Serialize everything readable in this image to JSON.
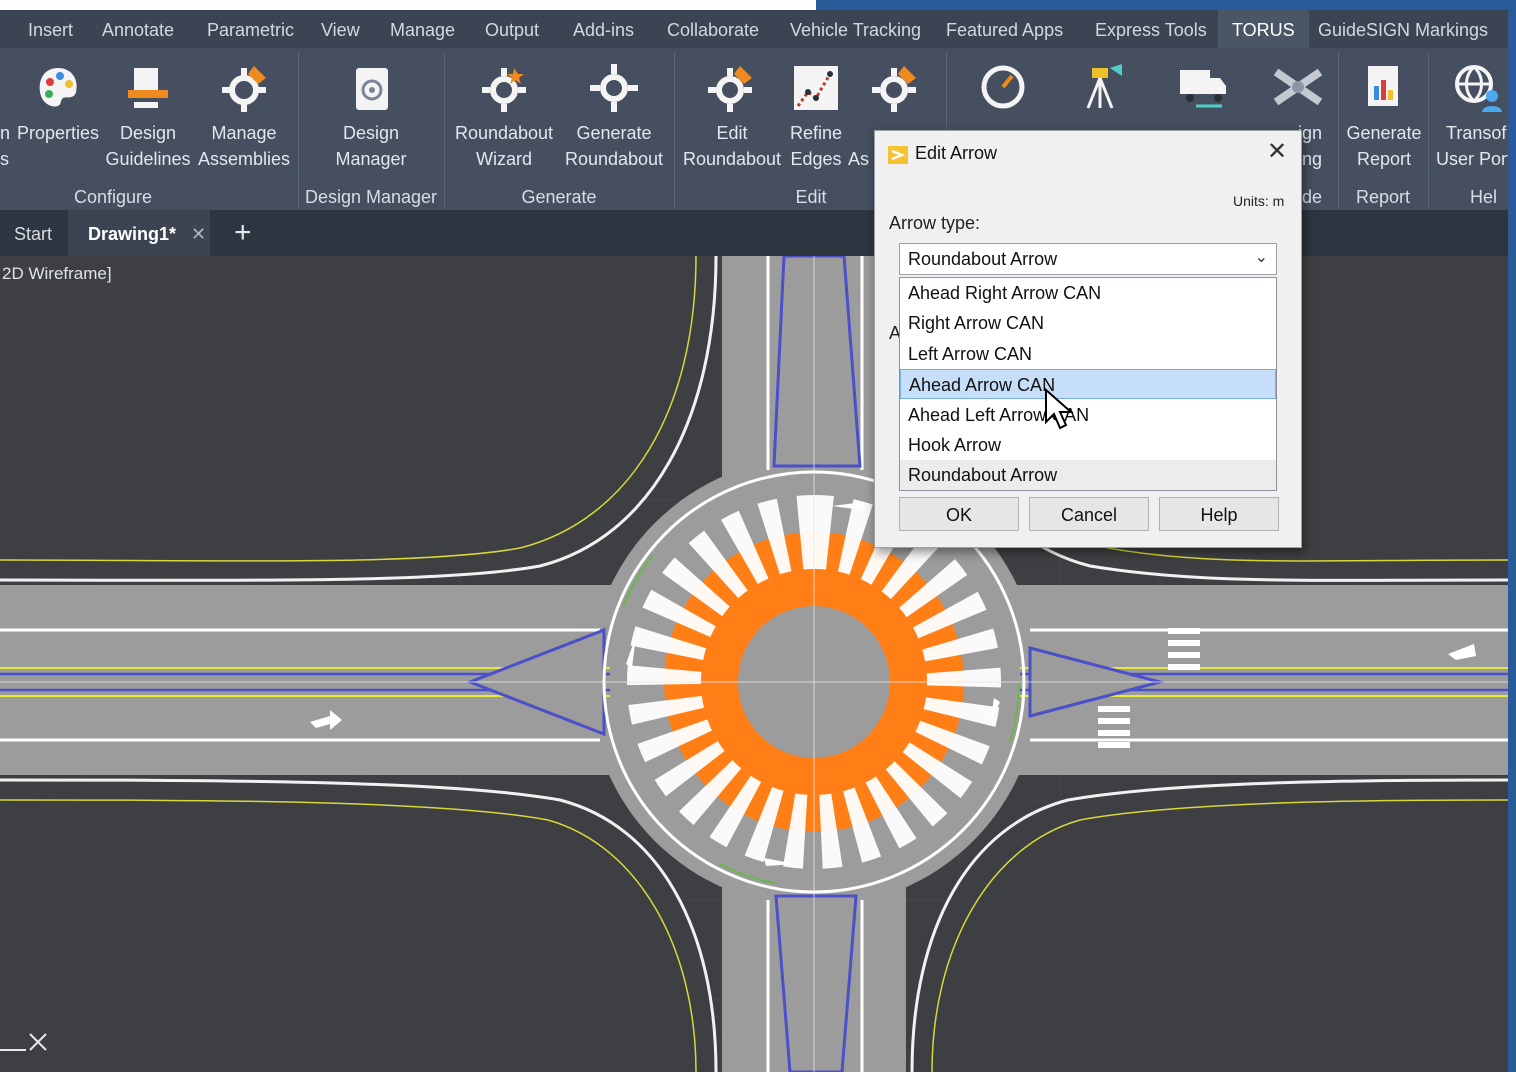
{
  "menu": {
    "tabs": [
      {
        "label": "Insert"
      },
      {
        "label": "Annotate"
      },
      {
        "label": "Parametric"
      },
      {
        "label": "View"
      },
      {
        "label": "Manage"
      },
      {
        "label": "Output"
      },
      {
        "label": "Add-ins"
      },
      {
        "label": "Collaborate"
      },
      {
        "label": "Vehicle Tracking"
      },
      {
        "label": "Featured Apps"
      },
      {
        "label": "Express Tools"
      },
      {
        "label": "TORUS"
      },
      {
        "label": "GuideSIGN Markings"
      }
    ]
  },
  "ribbon": {
    "buttons": {
      "partial_left": {
        "line1": "n",
        "line2": "s"
      },
      "properties": {
        "line1": "Properties"
      },
      "design_guidelines": {
        "line1": "Design",
        "line2": "Guidelines"
      },
      "manage_assemblies": {
        "line1": "Manage",
        "line2": "Assemblies"
      },
      "design_manager": {
        "line1": "Design",
        "line2": "Manager"
      },
      "roundabout_wizard": {
        "line1": "Roundabout",
        "line2": "Wizard"
      },
      "generate_roundabout": {
        "line1": "Generate",
        "line2": "Roundabout"
      },
      "edit_roundabout": {
        "line1": "Edit",
        "line2": "Roundabout"
      },
      "refine_edges": {
        "line1": "Refine",
        "line2": "Edges"
      },
      "as_partial": {
        "line2": "As"
      },
      "design_partial": {
        "line1": "ign",
        "line2": "ing"
      },
      "generate_report": {
        "line1": "Generate",
        "line2": "Report"
      },
      "transform": {
        "line1": "Transof",
        "line2": "User Port"
      }
    },
    "groups": {
      "configure": "Configure",
      "design_manager": "Design Manager",
      "generate": "Generate",
      "edit": "Edit",
      "de_partial": "de",
      "report": "Report",
      "help_partial": "Hel"
    }
  },
  "doc_tabs": {
    "start": "Start",
    "drawing": "Drawing1*",
    "close_glyph": "✕",
    "new_glyph": "+"
  },
  "viewport": {
    "label": "2D Wireframe]"
  },
  "dialog": {
    "title": "Edit Arrow",
    "close_glyph": "✕",
    "units": "Units: m",
    "arrow_type_label": "Arrow type:",
    "selected": "Roundabout Arrow",
    "chevron": "⌄",
    "hidden_label_stub": "A",
    "options": [
      {
        "label": "Ahead Right Arrow CAN"
      },
      {
        "label": "Right Arrow CAN"
      },
      {
        "label": "Left Arrow CAN"
      },
      {
        "label": "Ahead Arrow CAN"
      },
      {
        "label": "Ahead Left Arrow CAN"
      },
      {
        "label": "Hook Arrow"
      },
      {
        "label": "Roundabout Arrow"
      }
    ],
    "highlighted_option": "Ahead Arrow CAN",
    "ok": "OK",
    "cancel": "Cancel",
    "help": "Help"
  },
  "colors": {
    "ribbon_bg": "#454f5f",
    "tabbar_bg": "#3b4453",
    "canvas_bg": "#3d3f42",
    "road": "#9c9c9c",
    "island_orange": "#ff7f16",
    "edge_yellow": "#e7e83a",
    "island_blue": "#4b4fc8",
    "highlight": "#c7def8",
    "frame_blue": "#2a5b98"
  }
}
